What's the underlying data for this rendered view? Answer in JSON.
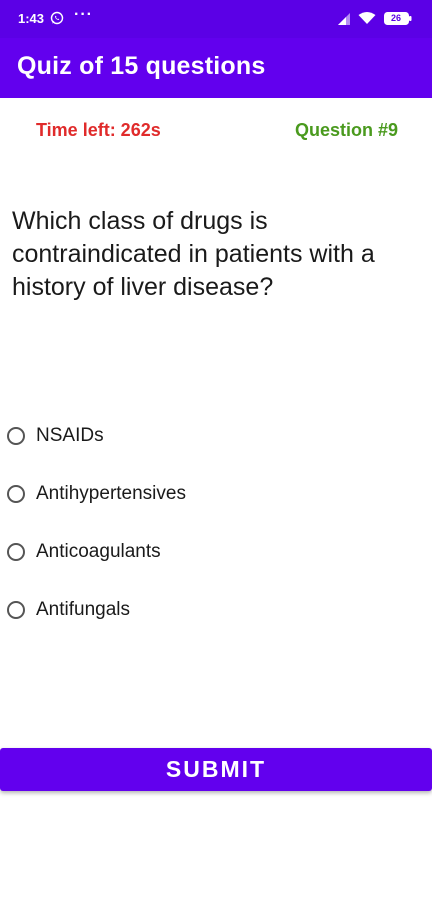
{
  "status_bar": {
    "time": "1:43",
    "more": "···",
    "battery_level": "26"
  },
  "app_bar": {
    "title": "Quiz of 15 questions"
  },
  "quiz": {
    "time_left": "Time left: 262s",
    "question_number": "Question #9",
    "question": "Which class of drugs is contraindicated in patients with a history of liver disease?",
    "options": [
      {
        "label": "NSAIDs",
        "selected": false
      },
      {
        "label": "Antihypertensives",
        "selected": false
      },
      {
        "label": "Anticoagulants",
        "selected": false
      },
      {
        "label": "Antifungals",
        "selected": false
      }
    ],
    "submit_label": "SUBMIT"
  },
  "colors": {
    "primary": "#6200ee",
    "status_bar": "#5b00e6",
    "time_left": "#e02b2b",
    "question_number": "#4a9a1e"
  },
  "icons": [
    "whatsapp-icon",
    "signal-icon",
    "wifi-icon",
    "battery-icon",
    "radio-button-icon"
  ]
}
